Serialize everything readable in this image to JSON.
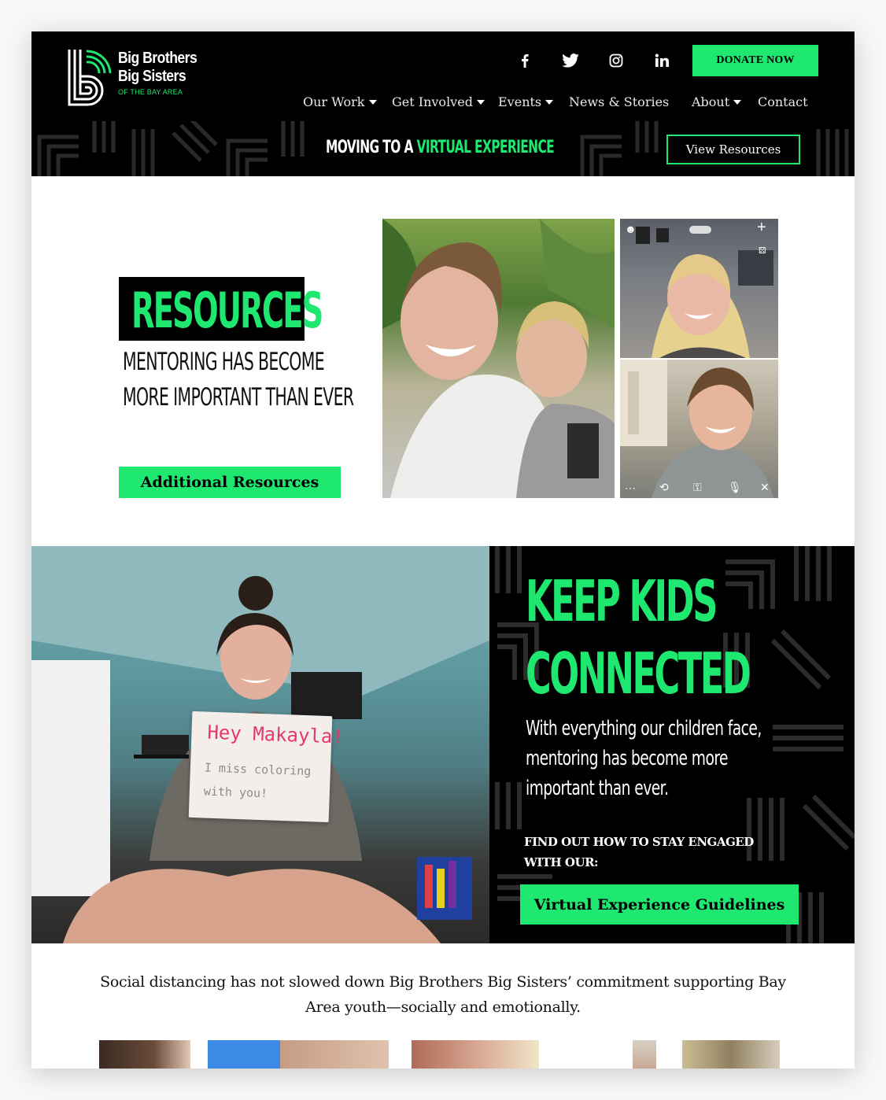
{
  "header": {
    "logo_line1": "Big Brothers",
    "logo_line2": "Big Sisters",
    "logo_sub": "OF THE BAY AREA",
    "social": [
      {
        "icon": "facebook-icon",
        "glyph": "f"
      },
      {
        "icon": "twitter-icon",
        "glyph": "t"
      },
      {
        "icon": "instagram-icon",
        "glyph": "◎"
      },
      {
        "icon": "linkedin-icon",
        "glyph": "in"
      }
    ],
    "donate_label": "DONATE NOW",
    "nav": [
      {
        "label": "Our Work",
        "dropdown": true
      },
      {
        "label": "Get Involved",
        "dropdown": true
      },
      {
        "label": "Events",
        "dropdown": true
      },
      {
        "label": "News & Stories",
        "dropdown": false
      },
      {
        "label": "About",
        "dropdown": true
      },
      {
        "label": "Contact",
        "dropdown": false
      }
    ]
  },
  "banner": {
    "prefix": "MOVING TO A ",
    "highlight": "VIRTUAL EXPERIENCE",
    "button": "View Resources"
  },
  "resources": {
    "title": "RESOURCES",
    "subtitle_line1": "MENTORING HAS BECOME",
    "subtitle_line2": "MORE IMPORTANT THAN EVER",
    "button": "Additional Resources"
  },
  "keep_kids": {
    "title_line1": "KEEP KIDS",
    "title_line2": "CONNECTED",
    "body_line1": "With everything our children face,",
    "body_line2": "mentoring has become more",
    "body_line3": "important than ever.",
    "find_line1": "FIND OUT HOW TO STAY ENGAGED",
    "find_line2": "WITH OUR:",
    "button": "Virtual Experience Guidelines",
    "sign_line1": "Hey Makayla!",
    "sign_line2": "I miss coloring",
    "sign_line3": "with you!"
  },
  "bottom": {
    "statement_line1": "Social distancing has not slowed down Big Brothers Big Sisters’ commitment supporting Bay",
    "statement_line2": "Area youth—socially and emotionally."
  },
  "colors": {
    "accent": "#1ee870",
    "header_bg": "#000000",
    "page_bg": "#ffffff"
  }
}
